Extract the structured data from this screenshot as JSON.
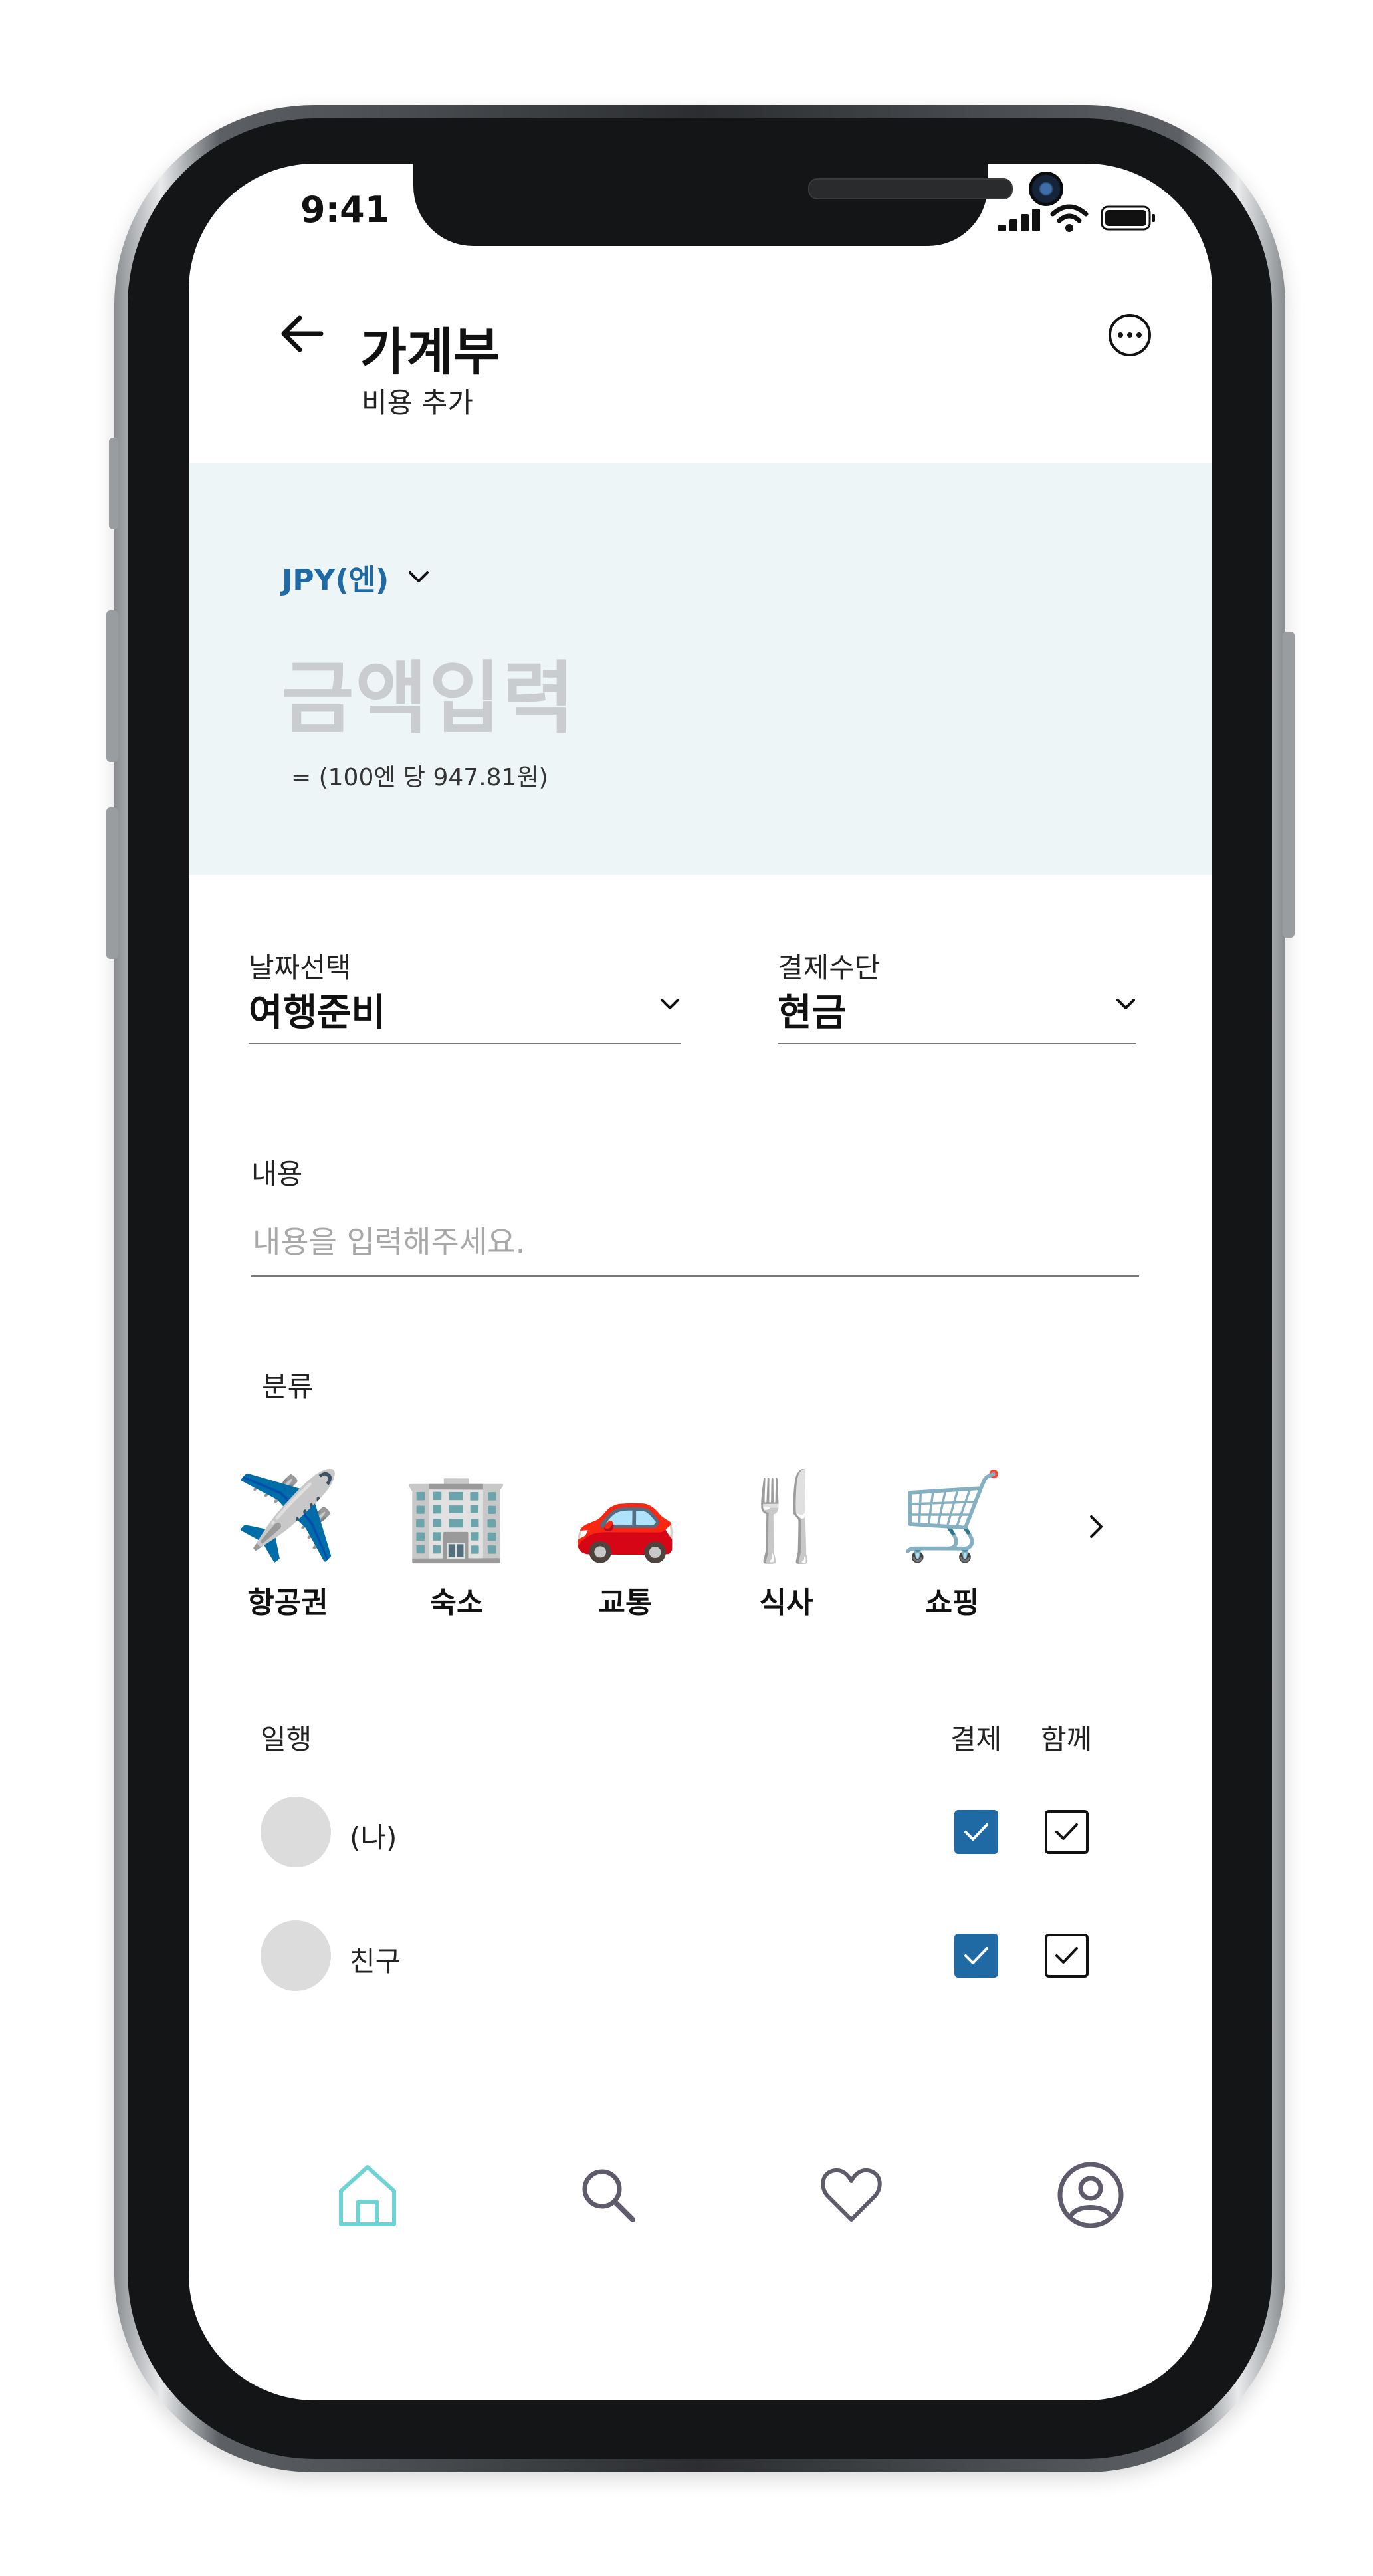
{
  "status_bar": {
    "time": "9:41"
  },
  "header": {
    "title": "가계부",
    "subtitle": "비용 추가"
  },
  "amount": {
    "currency": "JPY(엔)",
    "placeholder": "금액입력",
    "rate_text": "= (100엔 당  947.81원)"
  },
  "form": {
    "date": {
      "label": "날짜선택",
      "value": "여행준비"
    },
    "payment": {
      "label": "결제수단",
      "value": "현금"
    },
    "content": {
      "label": "내용",
      "placeholder": "내용을 입력해주세요."
    },
    "category_label": "분류"
  },
  "categories": [
    {
      "label": "항공권",
      "emoji": "✈️",
      "icon": "airplane-icon"
    },
    {
      "label": "숙소",
      "emoji": "🏢",
      "icon": "building-icon"
    },
    {
      "label": "교통",
      "emoji": "🚗",
      "icon": "car-icon"
    },
    {
      "label": "식사",
      "emoji": "🍴",
      "icon": "fork-knife-icon"
    },
    {
      "label": "쇼핑",
      "emoji": "🛒",
      "icon": "shopping-cart-icon"
    }
  ],
  "companions": {
    "label": "일행",
    "col_pay": "결제",
    "col_together": "함께",
    "people": [
      {
        "name": "(나)",
        "pay": true,
        "together": true
      },
      {
        "name": "친구",
        "pay": true,
        "together": true
      }
    ]
  },
  "nav": {
    "items": [
      "home-icon",
      "search-icon",
      "heart-icon",
      "profile-icon"
    ],
    "active": "home-icon"
  },
  "colors": {
    "accent": "#1f6aa5",
    "panel_bg": "#eef5f7",
    "home_active": "#6fd3d6",
    "nav_inactive": "#5f5b6b"
  }
}
